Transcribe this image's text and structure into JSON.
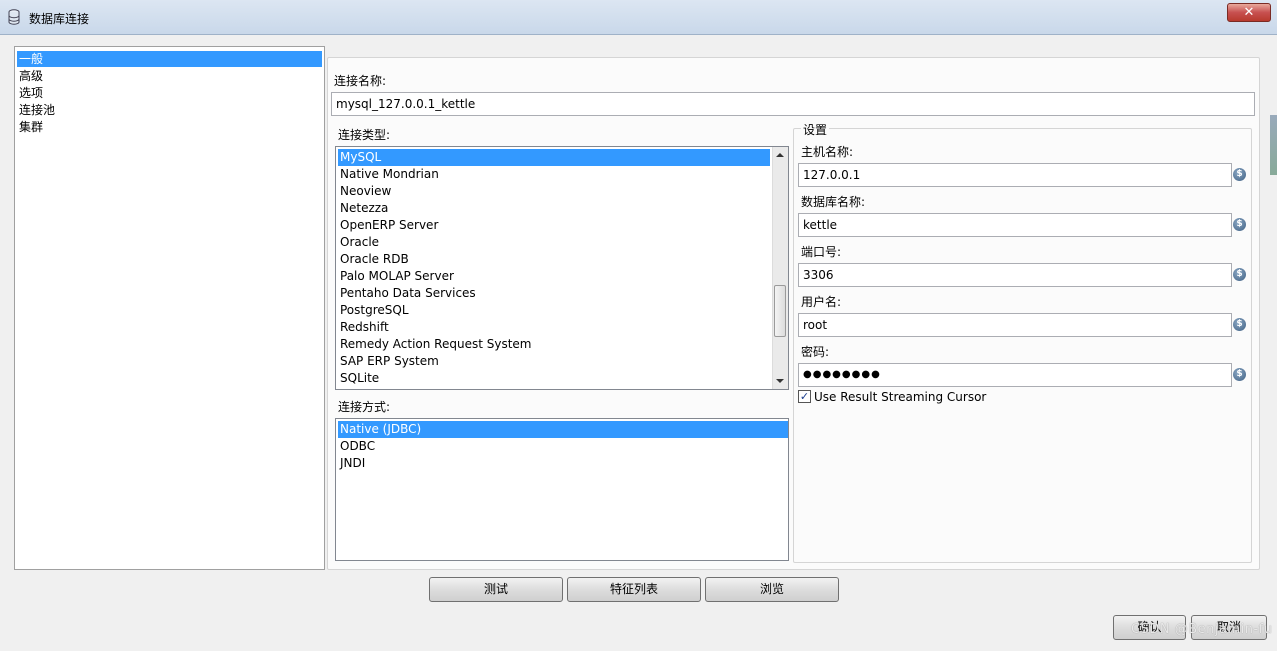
{
  "window": {
    "title": "数据库连接",
    "close_label": "✕"
  },
  "nav": {
    "items": [
      "一般",
      "高级",
      "选项",
      "连接池",
      "集群"
    ],
    "selected_index": 0
  },
  "form": {
    "connection_name_label": "连接名称:",
    "connection_name_value": "mysql_127.0.0.1_kettle",
    "connection_type_label": "连接类型:",
    "connection_types": [
      "MySQL",
      "Native Mondrian",
      "Neoview",
      "Netezza",
      "OpenERP Server",
      "Oracle",
      "Oracle RDB",
      "Palo MOLAP Server",
      "Pentaho Data Services",
      "PostgreSQL",
      "Redshift",
      "Remedy Action Request System",
      "SAP ERP System",
      "SQLite"
    ],
    "connection_type_selected": "MySQL",
    "access_label": "连接方式:",
    "access_methods": [
      "Native (JDBC)",
      "ODBC",
      "JNDI"
    ],
    "access_selected": "Native (JDBC)"
  },
  "settings": {
    "group_label": "设置",
    "host_label": "主机名称:",
    "host_value": "127.0.0.1",
    "db_label": "数据库名称:",
    "db_value": "kettle",
    "port_label": "端口号:",
    "port_value": "3306",
    "user_label": "用户名:",
    "user_value": "root",
    "password_label": "密码:",
    "password_value": "●●●●●●●●",
    "streaming_label": "Use Result Streaming Cursor",
    "streaming_checked": true,
    "var_icon": "$"
  },
  "buttons": {
    "test": "测试",
    "features": "特征列表",
    "browse": "浏览",
    "ok": "确认",
    "cancel": "取消"
  },
  "watermark": "CSDN @Benjamin-fu"
}
